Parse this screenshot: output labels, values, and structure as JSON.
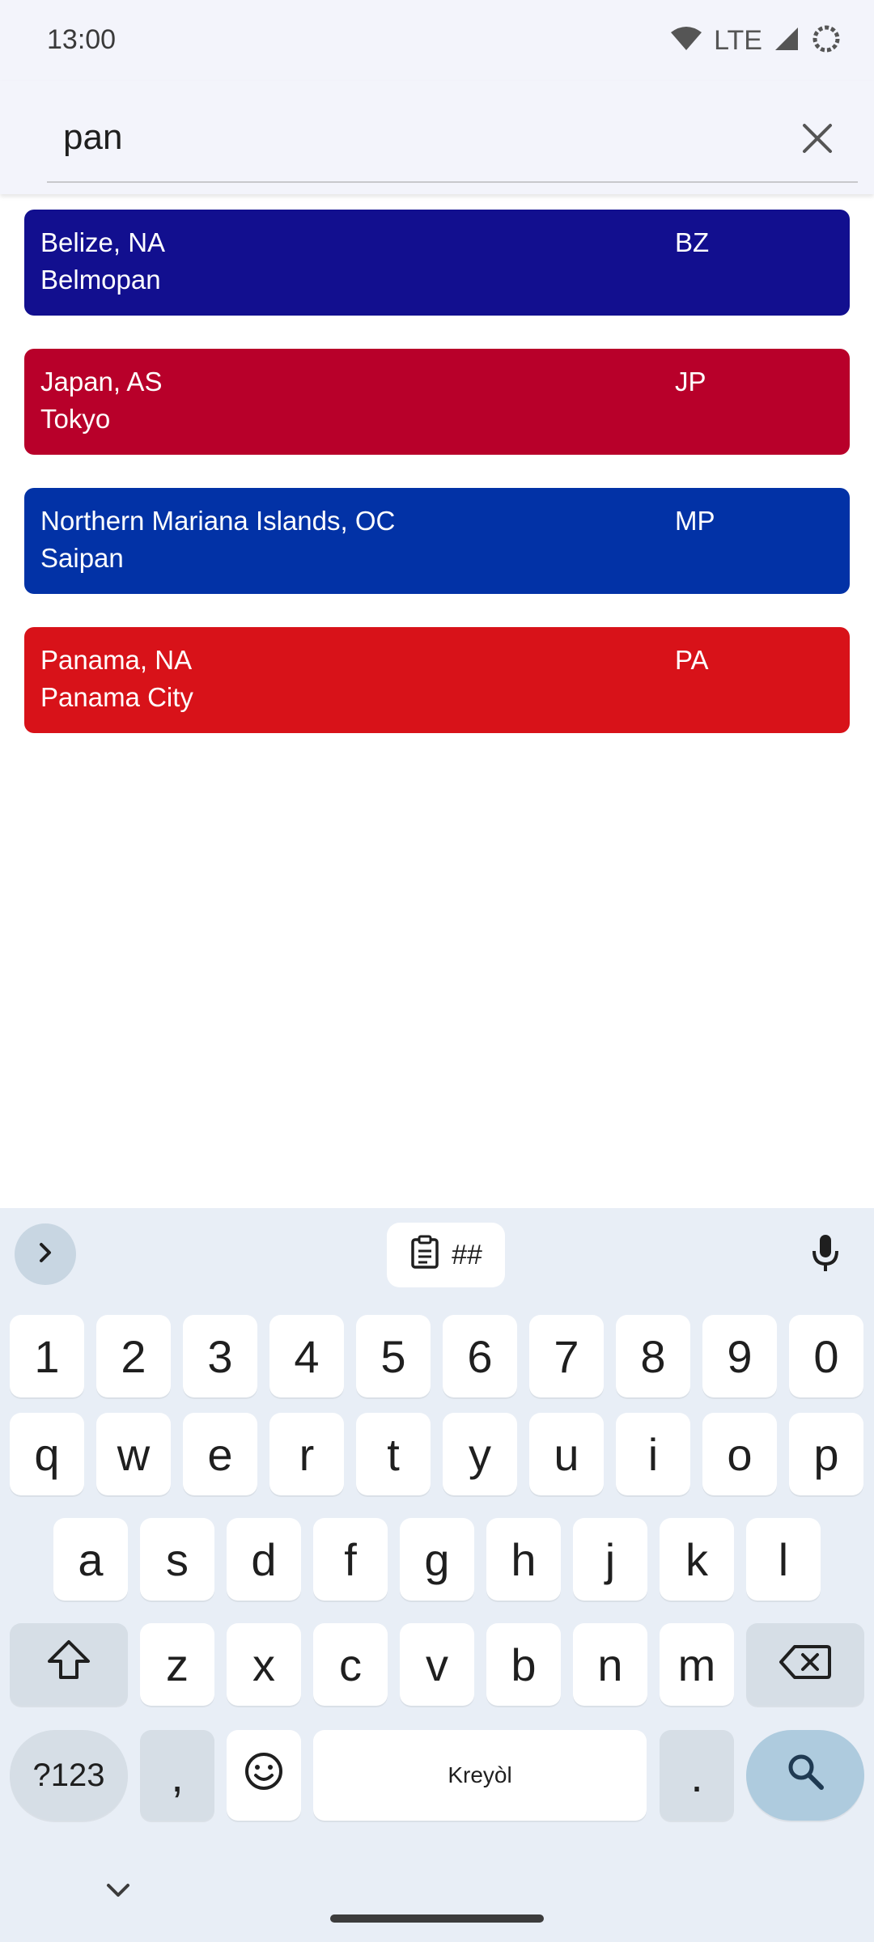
{
  "status_bar": {
    "time": "13:00",
    "network": "LTE"
  },
  "search": {
    "query": "pan",
    "clear_icon": "close-icon"
  },
  "results": [
    {
      "name": "Belize, NA",
      "capital": "Belmopan",
      "code": "BZ",
      "color": "#120f8f"
    },
    {
      "name": "Japan, AS",
      "capital": "Tokyo",
      "code": "JP",
      "color": "#b8002a"
    },
    {
      "name": "Northern Mariana Islands, OC",
      "capital": "Saipan",
      "code": "MP",
      "color": "#0232a6"
    },
    {
      "name": "Panama, NA",
      "capital": "Panama City",
      "code": "PA",
      "color": "#d81219"
    }
  ],
  "keyboard": {
    "clipboard_label": "##",
    "number_row": [
      "1",
      "2",
      "3",
      "4",
      "5",
      "6",
      "7",
      "8",
      "9",
      "0"
    ],
    "row1": [
      "q",
      "w",
      "e",
      "r",
      "t",
      "y",
      "u",
      "i",
      "o",
      "p"
    ],
    "row2": [
      "a",
      "s",
      "d",
      "f",
      "g",
      "h",
      "j",
      "k",
      "l"
    ],
    "row3": [
      "z",
      "x",
      "c",
      "v",
      "b",
      "n",
      "m"
    ],
    "symbols_label": "?123",
    "comma_label": ",",
    "space_label": "Kreyòl",
    "period_label": ".",
    "accent_color": "#aecbde"
  }
}
